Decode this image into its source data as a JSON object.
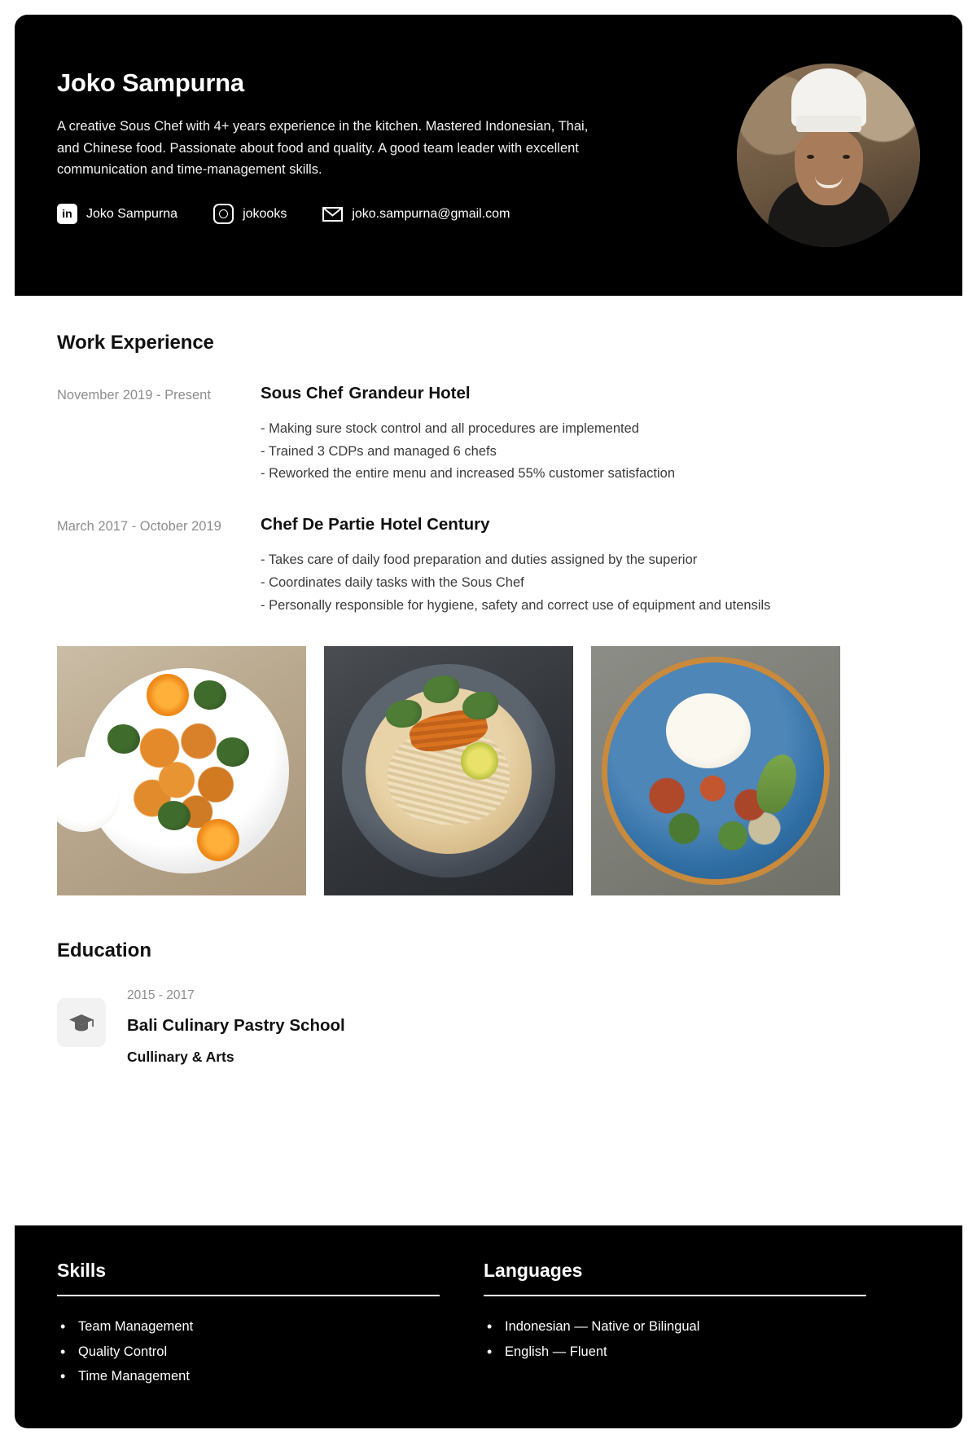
{
  "header": {
    "name": "Joko Sampurna",
    "summary": "A creative Sous Chef with 4+ years experience in the kitchen. Mastered Indonesian, Thai, and Chinese food. Passionate about food and quality. A good team leader with excellent communication and time-management skills.",
    "contacts": [
      {
        "icon": "linkedin-icon",
        "glyph": "in",
        "label": "Joko Sampurna"
      },
      {
        "icon": "instagram-icon",
        "glyph": "",
        "label": "jokooks"
      },
      {
        "icon": "email-icon",
        "glyph": "",
        "label": "joko.sampurna@gmail.com"
      }
    ],
    "avatar_alt": "Chef portrait"
  },
  "work": {
    "title": "Work Experience",
    "jobs": [
      {
        "date": "November 2019 - Present",
        "role": "Sous Chef",
        "company": "Grandeur Hotel",
        "bullets": [
          "- Making sure stock control and all procedures are implemented",
          "- Trained 3 CDPs and managed 6 chefs",
          "- Reworked the entire menu and increased 55% customer satisfaction"
        ]
      },
      {
        "date": "March 2017 - October 2019",
        "role": "Chef De Partie",
        "company": "Hotel Century",
        "bullets": [
          "- Takes care of daily food preparation and duties assigned by the superior",
          "- Coordinates daily tasks with the Sous Chef",
          "- Personally responsible for hygiene, safety and correct use of equipment and utensils"
        ]
      }
    ]
  },
  "gallery": [
    {
      "name": "dish-photo-orange-chicken"
    },
    {
      "name": "dish-photo-noodle-soup"
    },
    {
      "name": "dish-photo-rice-plate"
    }
  ],
  "education": {
    "title": "Education",
    "icon": "graduation-cap-icon",
    "entries": [
      {
        "years": "2015 - 2017",
        "school": "Bali Culinary Pastry School",
        "major": "Cullinary & Arts"
      }
    ]
  },
  "footer": {
    "skills": {
      "heading": "Skills",
      "items": [
        "Team Management",
        "Quality Control",
        "Time Management"
      ]
    },
    "languages": {
      "heading": "Languages",
      "items": [
        "Indonesian — Native or Bilingual",
        "English — Fluent"
      ]
    }
  },
  "colors": {
    "ink": "#000000",
    "paper": "#ffffff",
    "muted": "#8d8d8d",
    "body_text": "#3b3b3b",
    "badge_bg": "#f2f2f2"
  }
}
